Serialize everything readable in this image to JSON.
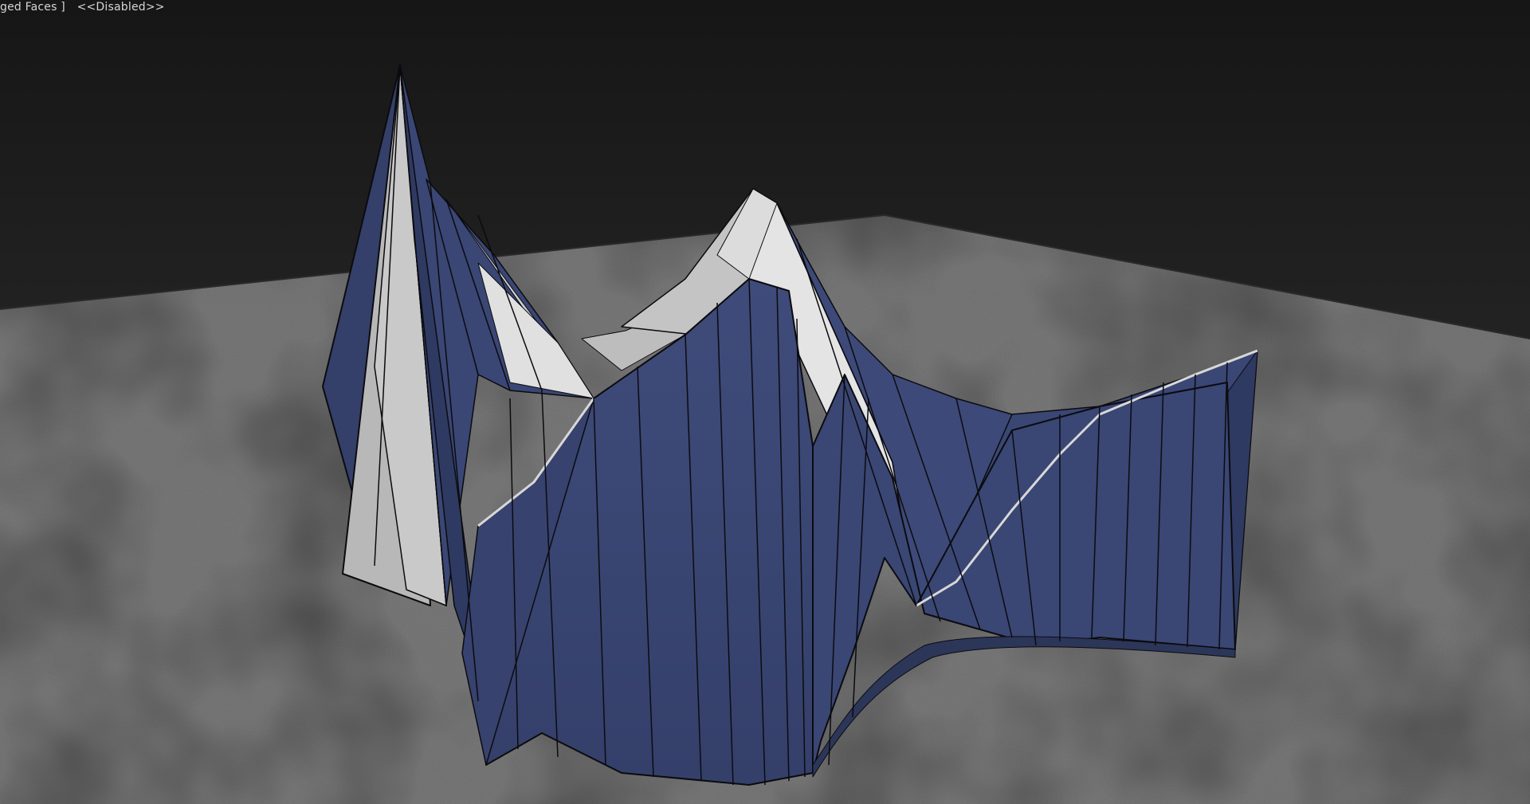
{
  "viewport": {
    "label_mode": "ged Faces ]",
    "label_state": "<<Disabled>>"
  },
  "colors": {
    "background_top": "#171717",
    "background_bottom": "#2d2d2d",
    "ground": "#7b7b7b",
    "surface_blue": "#39446e",
    "surface_light": "#c8c8c8",
    "edge": "#0b0b0f"
  }
}
